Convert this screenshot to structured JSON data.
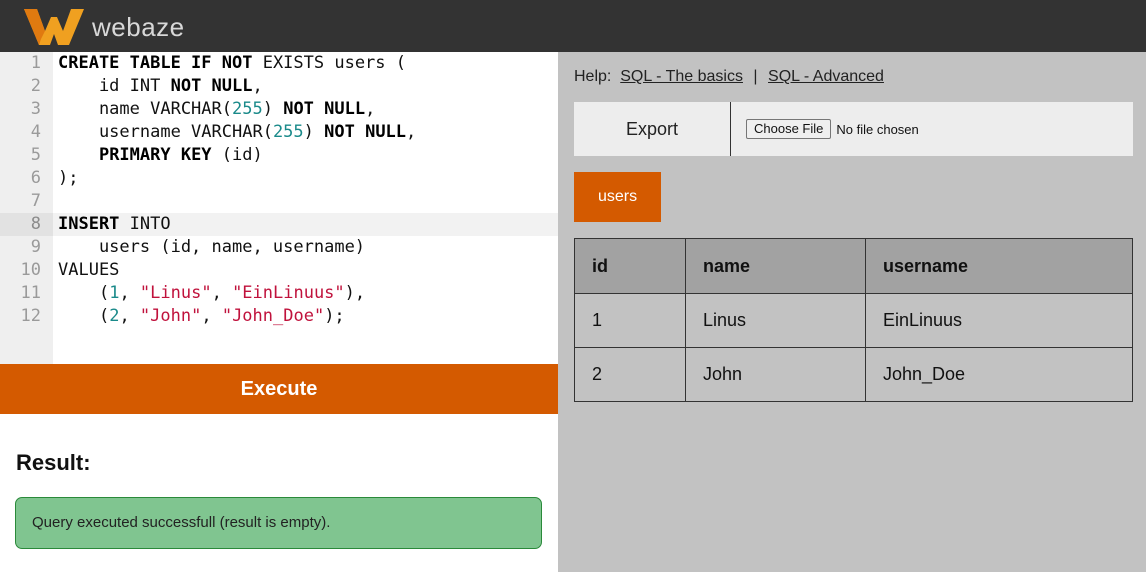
{
  "brand": {
    "name": "webaze"
  },
  "editor": {
    "lines": [
      {
        "n": "1",
        "parts": [
          {
            "t": "CREATE TABLE IF NOT",
            "c": "kw"
          },
          {
            "t": " EXISTS users ("
          }
        ]
      },
      {
        "n": "2",
        "parts": [
          {
            "t": "    id INT "
          },
          {
            "t": "NOT NULL",
            "c": "kw"
          },
          {
            "t": ","
          }
        ]
      },
      {
        "n": "3",
        "parts": [
          {
            "t": "    name VARCHAR("
          },
          {
            "t": "255",
            "c": "num"
          },
          {
            "t": ") "
          },
          {
            "t": "NOT NULL",
            "c": "kw"
          },
          {
            "t": ","
          }
        ]
      },
      {
        "n": "4",
        "parts": [
          {
            "t": "    username VARCHAR("
          },
          {
            "t": "255",
            "c": "num"
          },
          {
            "t": ") "
          },
          {
            "t": "NOT NULL",
            "c": "kw"
          },
          {
            "t": ","
          }
        ]
      },
      {
        "n": "5",
        "parts": [
          {
            "t": "    "
          },
          {
            "t": "PRIMARY KEY",
            "c": "kw"
          },
          {
            "t": " (id)"
          }
        ]
      },
      {
        "n": "6",
        "parts": [
          {
            "t": ");"
          }
        ]
      },
      {
        "n": "7",
        "parts": []
      },
      {
        "n": "8",
        "active": true,
        "parts": [
          {
            "t": "INSERT",
            "c": "kw"
          },
          {
            "t": " INTO"
          }
        ]
      },
      {
        "n": "9",
        "parts": [
          {
            "t": "    users (id, name, username)"
          }
        ]
      },
      {
        "n": "10",
        "parts": [
          {
            "t": "VALUES"
          }
        ]
      },
      {
        "n": "11",
        "parts": [
          {
            "t": "    ("
          },
          {
            "t": "1",
            "c": "num"
          },
          {
            "t": ", "
          },
          {
            "t": "\"Linus\"",
            "c": "str"
          },
          {
            "t": ", "
          },
          {
            "t": "\"EinLinuus\"",
            "c": "str"
          },
          {
            "t": "),"
          }
        ]
      },
      {
        "n": "12",
        "parts": [
          {
            "t": "    ("
          },
          {
            "t": "2",
            "c": "num"
          },
          {
            "t": ", "
          },
          {
            "t": "\"John\"",
            "c": "str"
          },
          {
            "t": ", "
          },
          {
            "t": "\"John_Doe\"",
            "c": "str"
          },
          {
            "t": ");"
          }
        ]
      }
    ]
  },
  "execute_label": "Execute",
  "result": {
    "title": "Result:",
    "message": "Query executed successfull (result is empty)."
  },
  "help": {
    "label": "Help:",
    "link1": "SQL - The basics",
    "separator": "|",
    "link2": "SQL - Advanced"
  },
  "export": {
    "button_label": "Export",
    "choose_file_label": "Choose File",
    "no_file_text": "No file chosen"
  },
  "tables": [
    "users"
  ],
  "data_table": {
    "headers": [
      "id",
      "name",
      "username"
    ],
    "rows": [
      [
        "1",
        "Linus",
        "EinLinuus"
      ],
      [
        "2",
        "John",
        "John_Doe"
      ]
    ]
  },
  "colors": {
    "accent": "#d45a00",
    "topbar": "#333333",
    "success_bg": "#80c590"
  }
}
